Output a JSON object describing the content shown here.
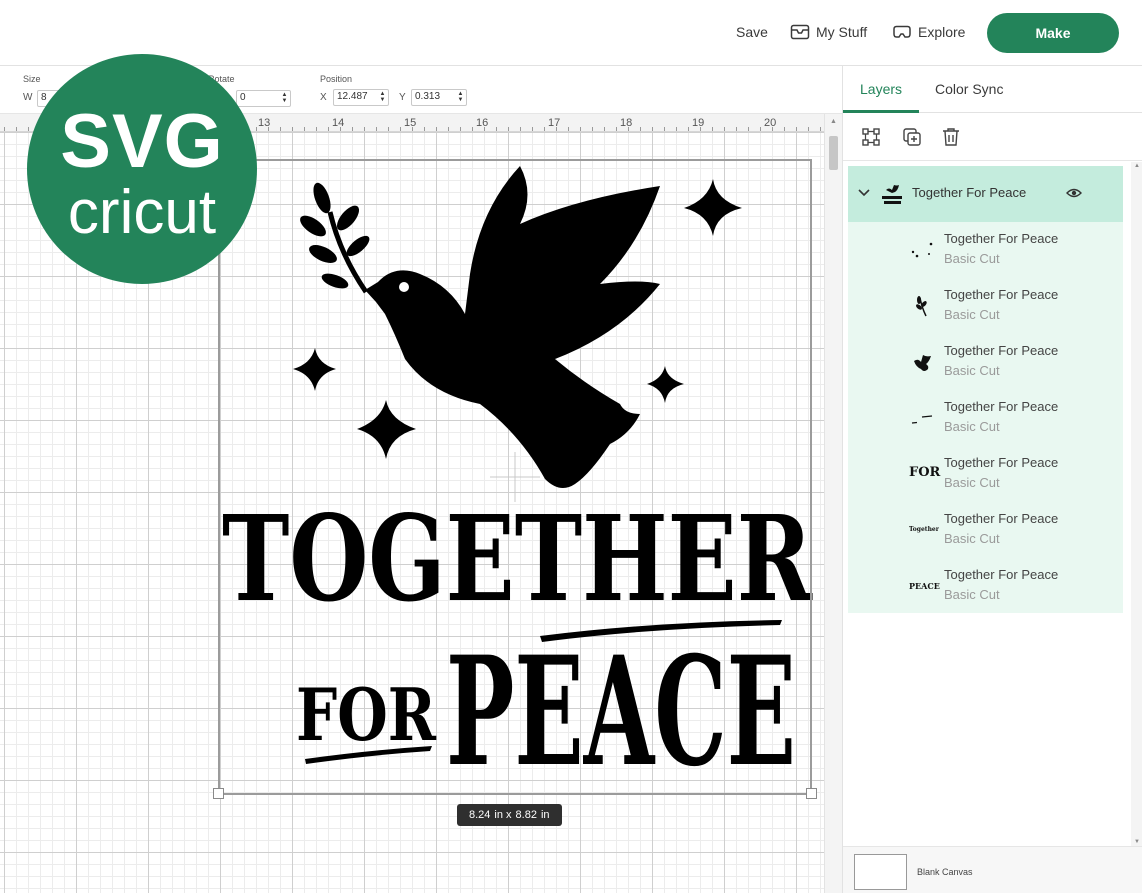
{
  "topbar": {
    "save": "Save",
    "my_stuff": "My Stuff",
    "explore": "Explore",
    "make": "Make",
    "make_color": "#23845a"
  },
  "toolbar": {
    "size_label": "Size",
    "w_label": "W",
    "w_value": "8",
    "rotate_label": "Rotate",
    "rotate_value": "0",
    "position_label": "Position",
    "x_label": "X",
    "x_value": "12.487",
    "y_label": "Y",
    "y_value": "0.313"
  },
  "ruler": {
    "numbers": [
      "13",
      "14",
      "15",
      "16",
      "17",
      "18",
      "19",
      "20"
    ]
  },
  "badge": {
    "line1": "SVG",
    "line2": "cricut",
    "color": "#23845a"
  },
  "design": {
    "word1": "TOGETHER",
    "word2": "FOR",
    "word3": "PEACE"
  },
  "size_tag": {
    "w": "8.24",
    "w_unit": "in x",
    "h": "8.82",
    "h_unit": "in"
  },
  "panel": {
    "tabs": [
      "Layers",
      "Color Sync"
    ],
    "tool_icons": [
      "group-icon",
      "duplicate-icon",
      "trash-icon"
    ],
    "group": {
      "name": "Together For Peace",
      "thumb_icon": "dove-logo-thumb-icon",
      "expand_icon": "chevron-down-icon",
      "visibility_icon": "eye-icon"
    },
    "layers": [
      {
        "name": "Together For Peace",
        "sub": "Basic Cut",
        "thumb_icon": "sparkles-thumb-icon"
      },
      {
        "name": "Together For Peace",
        "sub": "Basic Cut",
        "thumb_icon": "branch-thumb-icon"
      },
      {
        "name": "Together For Peace",
        "sub": "Basic Cut",
        "thumb_icon": "dove-thumb-icon"
      },
      {
        "name": "Together For Peace",
        "sub": "Basic Cut",
        "thumb_icon": "lines-thumb-icon"
      },
      {
        "name": "Together For Peace",
        "sub": "Basic Cut",
        "thumb_text": "FOR"
      },
      {
        "name": "Together For Peace",
        "sub": "Basic Cut",
        "thumb_text": "Together"
      },
      {
        "name": "Together For Peace",
        "sub": "Basic Cut",
        "thumb_text": "PEACE"
      }
    ],
    "blank_canvas": "Blank Canvas",
    "selected_group_color": "#c4ecdd",
    "children_color": "#e9f8f1"
  }
}
